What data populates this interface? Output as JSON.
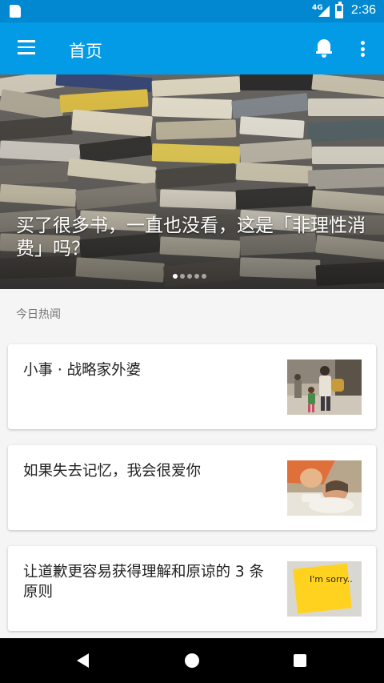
{
  "status_bar": {
    "network": "4G",
    "time": "2:36"
  },
  "app_bar": {
    "title": "首页",
    "icons": [
      "menu-icon",
      "bell-icon",
      "overflow-icon"
    ]
  },
  "banner": {
    "title": "买了很多书，一直也没看，这是「非理性消费」吗？",
    "page_indicator_count": 5,
    "page_indicator_active": 0
  },
  "section": {
    "label": "今日热闻"
  },
  "stories": [
    {
      "title": "小事 · 战略家外婆"
    },
    {
      "title": "如果失去记忆，我会很爱你"
    },
    {
      "title": "让道歉更容易获得理解和原谅的 3 条原则"
    }
  ],
  "thumbnails": {
    "story3_note_text": "I'm sorry.."
  },
  "colors": {
    "status_bar": "#0288d1",
    "app_bar": "#039be5",
    "background": "#f5f5f5"
  },
  "nav_bar": {
    "icons": [
      "back-icon",
      "home-icon",
      "recent-apps-icon"
    ]
  }
}
